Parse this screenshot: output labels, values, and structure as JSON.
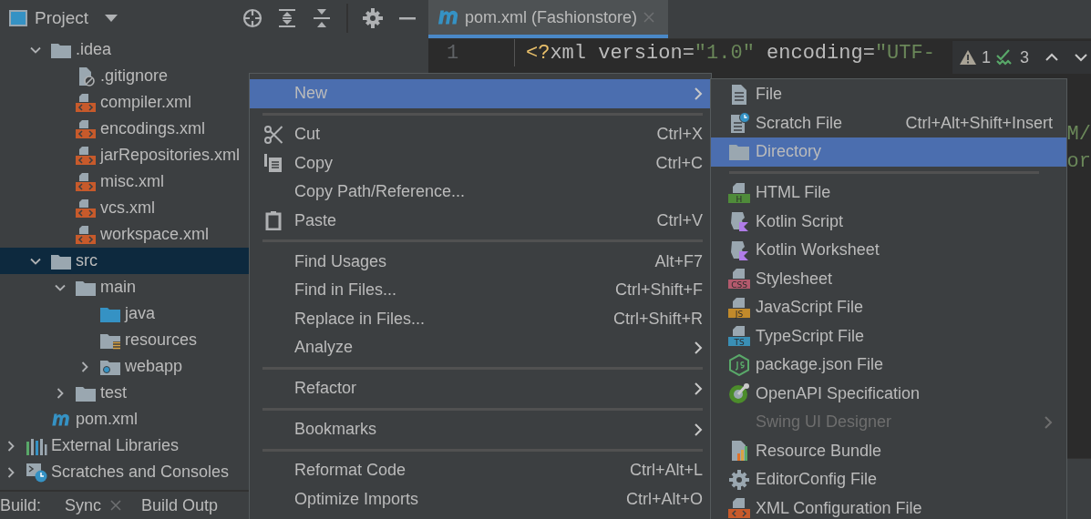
{
  "project_panel": {
    "title": "Project"
  },
  "tree": {
    "items": [
      {
        "label": ".idea",
        "kind": "folder",
        "expanded": true,
        "selected": false,
        "children": [
          {
            "label": ".gitignore",
            "kind": "ignored",
            "selected": false
          },
          {
            "label": "compiler.xml",
            "kind": "xml",
            "selected": false
          },
          {
            "label": "encodings.xml",
            "kind": "xml",
            "selected": false
          },
          {
            "label": "jarRepositories.xml",
            "kind": "xml",
            "selected": false
          },
          {
            "label": "misc.xml",
            "kind": "xml",
            "selected": false
          },
          {
            "label": "vcs.xml",
            "kind": "xml",
            "selected": false
          },
          {
            "label": "workspace.xml",
            "kind": "xml",
            "selected": false
          }
        ]
      },
      {
        "label": "src",
        "kind": "folder",
        "expanded": true,
        "selected": true,
        "children": [
          {
            "label": "main",
            "kind": "folder",
            "expanded": true,
            "selected": false,
            "children": [
              {
                "label": "java",
                "kind": "source",
                "selected": false
              },
              {
                "label": "resources",
                "kind": "resources",
                "selected": false
              },
              {
                "label": "webapp",
                "kind": "web",
                "expanded": false,
                "selected": false
              }
            ]
          },
          {
            "label": "test",
            "kind": "folder",
            "expanded": false,
            "selected": false
          }
        ]
      },
      {
        "label": "pom.xml",
        "kind": "maven",
        "selected": false
      }
    ],
    "roots": [
      {
        "label": "External Libraries",
        "kind": "libraries",
        "expanded": false,
        "selected": false
      },
      {
        "label": "Scratches and Consoles",
        "kind": "scratches",
        "expanded": false,
        "selected": false
      }
    ]
  },
  "build_bar": {
    "label": "Build:",
    "tabs": [
      {
        "label": "Sync",
        "closable": true
      },
      {
        "label": "Build Outp",
        "closable": false
      }
    ]
  },
  "editor": {
    "tab": {
      "label": "pom.xml (Fashionstore)",
      "selected": true
    },
    "lines": [
      {
        "number": "1",
        "tokens": [
          {
            "text": "<?",
            "kind": "punct"
          },
          {
            "text": "xml version=",
            "kind": "plain"
          },
          {
            "text": "\"1.0\"",
            "kind": "string"
          },
          {
            "text": " encoding=",
            "kind": "plain"
          },
          {
            "text": "\"UTF-",
            "kind": "string"
          }
        ]
      }
    ],
    "fragments": [
      "M/",
      "or"
    ],
    "inspections": {
      "warnings": "1",
      "checks": "3"
    }
  },
  "context_menu": [
    {
      "kind": "plain",
      "label": "New",
      "submenu": true,
      "selected": true
    },
    {
      "kind": "separator"
    },
    {
      "kind": "cut",
      "label": "Cut",
      "shortcut": "Ctrl+X",
      "selected": false
    },
    {
      "kind": "copy",
      "label": "Copy",
      "shortcut": "Ctrl+C",
      "selected": false
    },
    {
      "kind": "plain",
      "label": "Copy Path/Reference...",
      "selected": false
    },
    {
      "kind": "paste",
      "label": "Paste",
      "shortcut": "Ctrl+V",
      "selected": false
    },
    {
      "kind": "separator"
    },
    {
      "kind": "plain",
      "label": "Find Usages",
      "shortcut": "Alt+F7",
      "selected": false
    },
    {
      "kind": "plain",
      "label": "Find in Files...",
      "shortcut": "Ctrl+Shift+F",
      "selected": false
    },
    {
      "kind": "plain",
      "label": "Replace in Files...",
      "shortcut": "Ctrl+Shift+R",
      "selected": false
    },
    {
      "kind": "plain",
      "label": "Analyze",
      "submenu": true,
      "selected": false
    },
    {
      "kind": "separator"
    },
    {
      "kind": "plain",
      "label": "Refactor",
      "submenu": true,
      "selected": false
    },
    {
      "kind": "separator"
    },
    {
      "kind": "plain",
      "label": "Bookmarks",
      "submenu": true,
      "selected": false
    },
    {
      "kind": "separator"
    },
    {
      "kind": "plain",
      "label": "Reformat Code",
      "shortcut": "Ctrl+Alt+L",
      "selected": false
    },
    {
      "kind": "plain",
      "label": "Optimize Imports",
      "shortcut": "Ctrl+Alt+O",
      "selected": false
    }
  ],
  "new_submenu": [
    {
      "kind": "file",
      "label": "File",
      "selected": false,
      "disabled": false
    },
    {
      "kind": "scratch",
      "label": "Scratch File",
      "shortcut": "Ctrl+Alt+Shift+Insert",
      "selected": false,
      "disabled": false
    },
    {
      "kind": "directory",
      "label": "Directory",
      "selected": true,
      "disabled": false
    },
    {
      "kind": "separator"
    },
    {
      "kind": "badge",
      "label": "HTML File",
      "badge": "H",
      "color": "#4f8b3a",
      "selected": false,
      "disabled": false
    },
    {
      "kind": "kotlin",
      "label": "Kotlin Script",
      "selected": false,
      "disabled": false
    },
    {
      "kind": "kotlin",
      "label": "Kotlin Worksheet",
      "selected": false,
      "disabled": false
    },
    {
      "kind": "badge",
      "label": "Stylesheet",
      "badge": "CSS",
      "color": "#b35a6d",
      "selected": false,
      "disabled": false
    },
    {
      "kind": "badge",
      "label": "JavaScript File",
      "badge": "JS",
      "color": "#c18a2b",
      "selected": false,
      "disabled": false
    },
    {
      "kind": "badge",
      "label": "TypeScript File",
      "badge": "TS",
      "color": "#3a8fb5",
      "selected": false,
      "disabled": false
    },
    {
      "kind": "node",
      "label": "package.json File",
      "selected": false,
      "disabled": false
    },
    {
      "kind": "openapi",
      "label": "OpenAPI Specification",
      "selected": false,
      "disabled": false
    },
    {
      "kind": "plain",
      "label": "Swing UI Designer",
      "submenu": true,
      "selected": false,
      "disabled": true
    },
    {
      "kind": "bundle",
      "label": "Resource Bundle",
      "selected": false,
      "disabled": false
    },
    {
      "kind": "gear",
      "label": "EditorConfig File",
      "selected": false,
      "disabled": false
    },
    {
      "kind": "xml",
      "label": "XML Configuration File",
      "selected": false,
      "disabled": false
    }
  ]
}
